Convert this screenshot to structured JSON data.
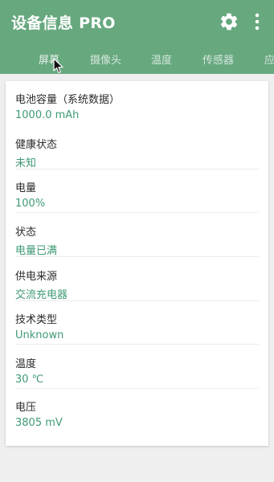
{
  "app": {
    "title": "设备信息 PRO",
    "accent_color": "#67a87f",
    "value_color": "#3f9a73"
  },
  "toolbar": {
    "settings_icon": "gear-icon",
    "more_icon": "more-vert-icon"
  },
  "tabs": [
    {
      "label": "屏幕"
    },
    {
      "label": "摄像头"
    },
    {
      "label": "温度"
    },
    {
      "label": "传感器"
    },
    {
      "label": "应"
    }
  ],
  "battery": {
    "rows": [
      {
        "label": "电池容量（系统数据）",
        "value": "1000.0 mAh"
      },
      {
        "label": "健康状态",
        "value": "未知"
      },
      {
        "label": "电量",
        "value": "100%"
      },
      {
        "label": "状态",
        "value": "电量已满"
      },
      {
        "label": "供电来源",
        "value": "交流充电器"
      },
      {
        "label": "技术类型",
        "value": "Unknown"
      },
      {
        "label": "温度",
        "value": "30 ℃"
      },
      {
        "label": "电压",
        "value": "3805 mV"
      }
    ]
  }
}
